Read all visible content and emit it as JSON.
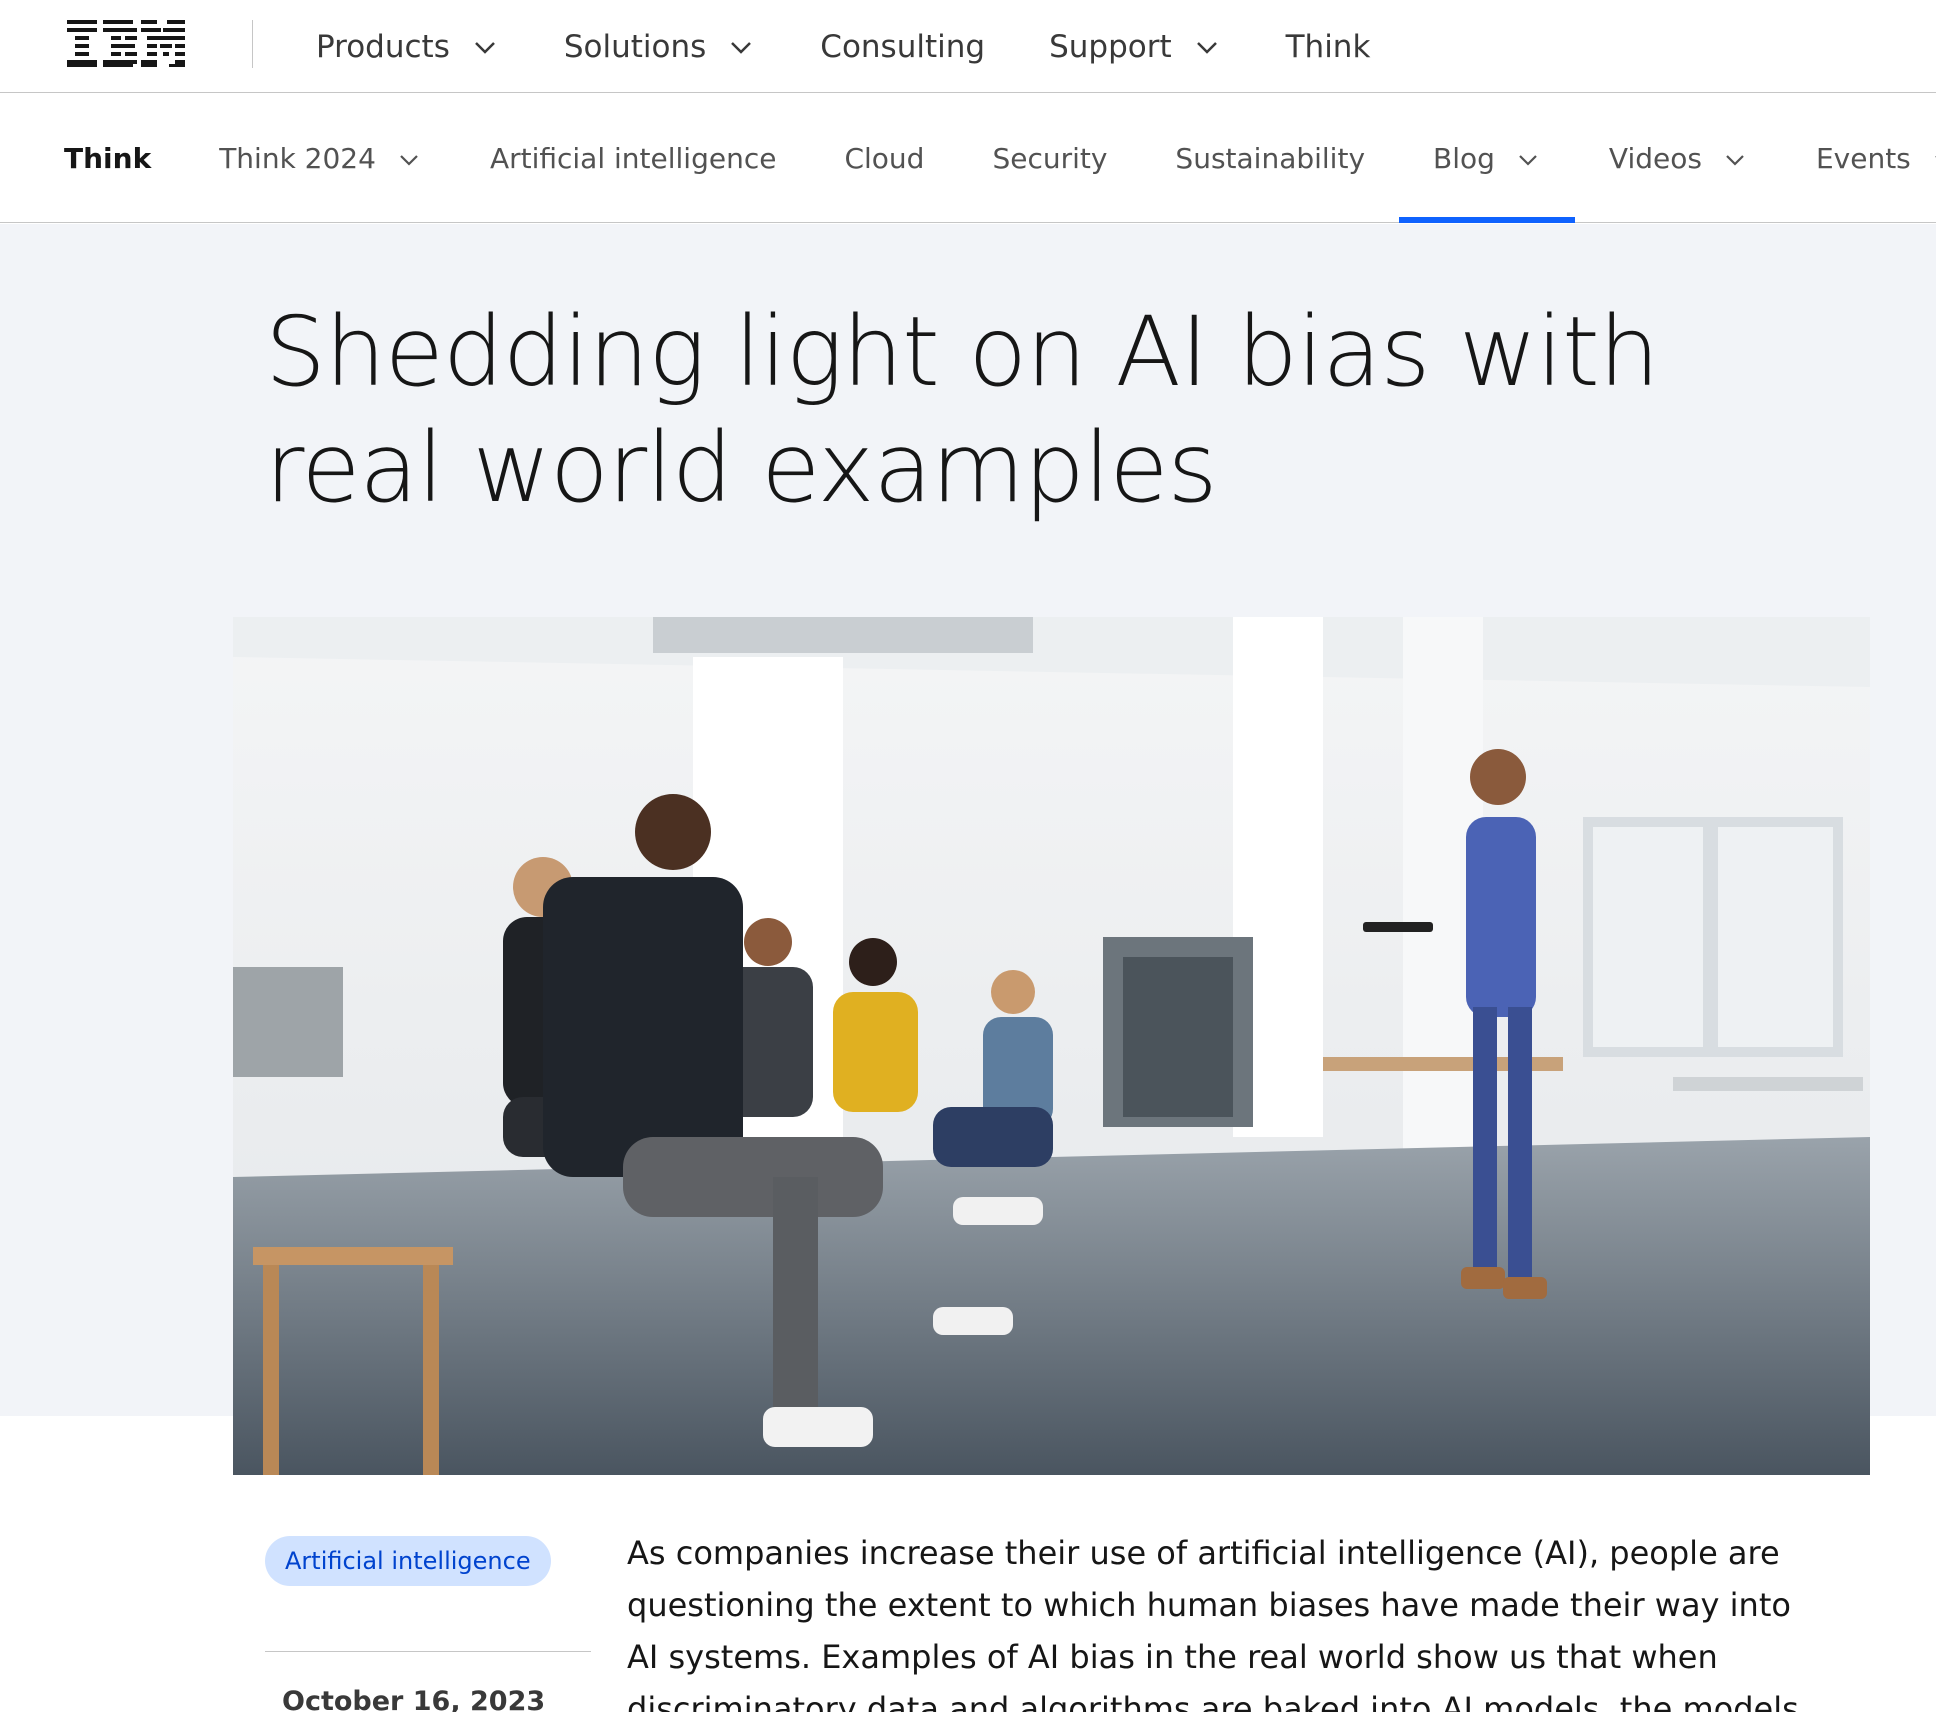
{
  "masthead": {
    "logo_text": "IBM",
    "nav": [
      {
        "label": "Products",
        "has_menu": true
      },
      {
        "label": "Solutions",
        "has_menu": true
      },
      {
        "label": "Consulting",
        "has_menu": false
      },
      {
        "label": "Support",
        "has_menu": true
      },
      {
        "label": "Think",
        "has_menu": false
      }
    ]
  },
  "subnav": {
    "brand": "Think",
    "items": [
      {
        "label": "Think 2024",
        "has_menu": true
      },
      {
        "label": "Artificial intelligence",
        "has_menu": false
      },
      {
        "label": "Cloud",
        "has_menu": false
      },
      {
        "label": "Security",
        "has_menu": false
      },
      {
        "label": "Sustainability",
        "has_menu": false
      },
      {
        "label": "Blog",
        "has_menu": true,
        "active": true
      },
      {
        "label": "Videos",
        "has_menu": true
      },
      {
        "label": "Events",
        "has_menu": true
      }
    ]
  },
  "article": {
    "title": "Shedding light on AI bias with real world examples",
    "tag": "Artificial intelligence",
    "date": "October 16, 2023",
    "intro": "As companies increase their use of artificial intelligence (AI), people are questioning the extent to which human biases have made their way into AI systems. Examples of AI bias in the real world show us that when discriminatory data and algorithms are baked into AI models, the models deploy biases at scale and amplify the resulting"
  },
  "colors": {
    "accent": "#0f62fe",
    "hero_bg": "#f2f4f8",
    "tag_bg": "#d0e2ff",
    "tag_text": "#0043ce",
    "text_primary": "#161616"
  },
  "icons": [
    "ibm-logo",
    "chevron-down-icon"
  ]
}
